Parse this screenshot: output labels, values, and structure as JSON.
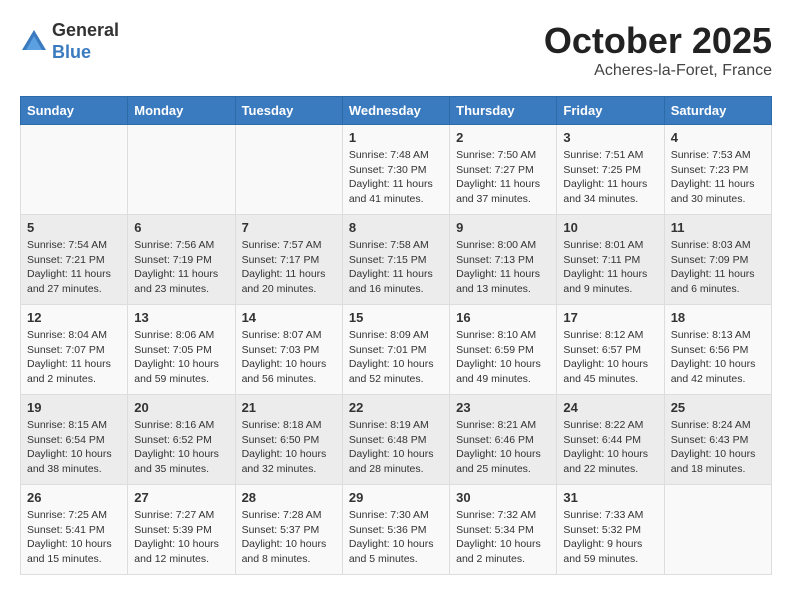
{
  "header": {
    "logo_general": "General",
    "logo_blue": "Blue",
    "month": "October 2025",
    "location": "Acheres-la-Foret, France"
  },
  "days_of_week": [
    "Sunday",
    "Monday",
    "Tuesday",
    "Wednesday",
    "Thursday",
    "Friday",
    "Saturday"
  ],
  "weeks": [
    [
      {
        "day": "",
        "content": ""
      },
      {
        "day": "",
        "content": ""
      },
      {
        "day": "",
        "content": ""
      },
      {
        "day": "1",
        "content": "Sunrise: 7:48 AM\nSunset: 7:30 PM\nDaylight: 11 hours and 41 minutes."
      },
      {
        "day": "2",
        "content": "Sunrise: 7:50 AM\nSunset: 7:27 PM\nDaylight: 11 hours and 37 minutes."
      },
      {
        "day": "3",
        "content": "Sunrise: 7:51 AM\nSunset: 7:25 PM\nDaylight: 11 hours and 34 minutes."
      },
      {
        "day": "4",
        "content": "Sunrise: 7:53 AM\nSunset: 7:23 PM\nDaylight: 11 hours and 30 minutes."
      }
    ],
    [
      {
        "day": "5",
        "content": "Sunrise: 7:54 AM\nSunset: 7:21 PM\nDaylight: 11 hours and 27 minutes."
      },
      {
        "day": "6",
        "content": "Sunrise: 7:56 AM\nSunset: 7:19 PM\nDaylight: 11 hours and 23 minutes."
      },
      {
        "day": "7",
        "content": "Sunrise: 7:57 AM\nSunset: 7:17 PM\nDaylight: 11 hours and 20 minutes."
      },
      {
        "day": "8",
        "content": "Sunrise: 7:58 AM\nSunset: 7:15 PM\nDaylight: 11 hours and 16 minutes."
      },
      {
        "day": "9",
        "content": "Sunrise: 8:00 AM\nSunset: 7:13 PM\nDaylight: 11 hours and 13 minutes."
      },
      {
        "day": "10",
        "content": "Sunrise: 8:01 AM\nSunset: 7:11 PM\nDaylight: 11 hours and 9 minutes."
      },
      {
        "day": "11",
        "content": "Sunrise: 8:03 AM\nSunset: 7:09 PM\nDaylight: 11 hours and 6 minutes."
      }
    ],
    [
      {
        "day": "12",
        "content": "Sunrise: 8:04 AM\nSunset: 7:07 PM\nDaylight: 11 hours and 2 minutes."
      },
      {
        "day": "13",
        "content": "Sunrise: 8:06 AM\nSunset: 7:05 PM\nDaylight: 10 hours and 59 minutes."
      },
      {
        "day": "14",
        "content": "Sunrise: 8:07 AM\nSunset: 7:03 PM\nDaylight: 10 hours and 56 minutes."
      },
      {
        "day": "15",
        "content": "Sunrise: 8:09 AM\nSunset: 7:01 PM\nDaylight: 10 hours and 52 minutes."
      },
      {
        "day": "16",
        "content": "Sunrise: 8:10 AM\nSunset: 6:59 PM\nDaylight: 10 hours and 49 minutes."
      },
      {
        "day": "17",
        "content": "Sunrise: 8:12 AM\nSunset: 6:57 PM\nDaylight: 10 hours and 45 minutes."
      },
      {
        "day": "18",
        "content": "Sunrise: 8:13 AM\nSunset: 6:56 PM\nDaylight: 10 hours and 42 minutes."
      }
    ],
    [
      {
        "day": "19",
        "content": "Sunrise: 8:15 AM\nSunset: 6:54 PM\nDaylight: 10 hours and 38 minutes."
      },
      {
        "day": "20",
        "content": "Sunrise: 8:16 AM\nSunset: 6:52 PM\nDaylight: 10 hours and 35 minutes."
      },
      {
        "day": "21",
        "content": "Sunrise: 8:18 AM\nSunset: 6:50 PM\nDaylight: 10 hours and 32 minutes."
      },
      {
        "day": "22",
        "content": "Sunrise: 8:19 AM\nSunset: 6:48 PM\nDaylight: 10 hours and 28 minutes."
      },
      {
        "day": "23",
        "content": "Sunrise: 8:21 AM\nSunset: 6:46 PM\nDaylight: 10 hours and 25 minutes."
      },
      {
        "day": "24",
        "content": "Sunrise: 8:22 AM\nSunset: 6:44 PM\nDaylight: 10 hours and 22 minutes."
      },
      {
        "day": "25",
        "content": "Sunrise: 8:24 AM\nSunset: 6:43 PM\nDaylight: 10 hours and 18 minutes."
      }
    ],
    [
      {
        "day": "26",
        "content": "Sunrise: 7:25 AM\nSunset: 5:41 PM\nDaylight: 10 hours and 15 minutes."
      },
      {
        "day": "27",
        "content": "Sunrise: 7:27 AM\nSunset: 5:39 PM\nDaylight: 10 hours and 12 minutes."
      },
      {
        "day": "28",
        "content": "Sunrise: 7:28 AM\nSunset: 5:37 PM\nDaylight: 10 hours and 8 minutes."
      },
      {
        "day": "29",
        "content": "Sunrise: 7:30 AM\nSunset: 5:36 PM\nDaylight: 10 hours and 5 minutes."
      },
      {
        "day": "30",
        "content": "Sunrise: 7:32 AM\nSunset: 5:34 PM\nDaylight: 10 hours and 2 minutes."
      },
      {
        "day": "31",
        "content": "Sunrise: 7:33 AM\nSunset: 5:32 PM\nDaylight: 9 hours and 59 minutes."
      },
      {
        "day": "",
        "content": ""
      }
    ]
  ]
}
